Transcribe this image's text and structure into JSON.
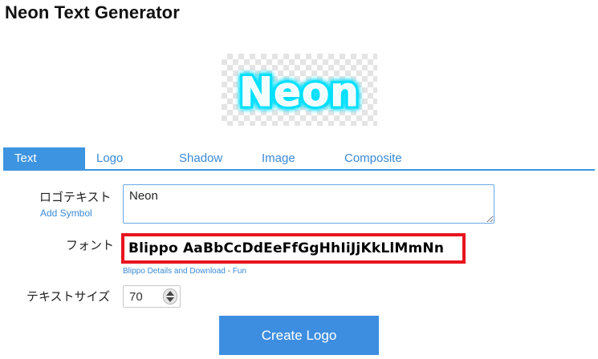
{
  "page": {
    "title": "Neon Text Generator"
  },
  "preview": {
    "text": "Neon",
    "glow_color": "#00e0ff",
    "fill_color": "#f2fdff"
  },
  "tabs": [
    {
      "label": "Text",
      "active": true
    },
    {
      "label": "Logo",
      "active": false
    },
    {
      "label": "Shadow",
      "active": false
    },
    {
      "label": "Image",
      "active": false
    },
    {
      "label": "Composite",
      "active": false
    }
  ],
  "form": {
    "logo_text": {
      "label": "ロゴテキスト",
      "value": "Neon",
      "add_symbol_link": "Add Symbol"
    },
    "font": {
      "label": "フォント",
      "sample": "Blippo AaBbCcDdEeFfGgHhIiJjKkLlMmNn",
      "details_link": "Blippo Details and Download",
      "separator": "-",
      "category_link": "Fun"
    },
    "text_size": {
      "label": "テキストサイズ",
      "value": "70"
    }
  },
  "actions": {
    "create_label": "Create Logo"
  },
  "colors": {
    "accent": "#3d94e0",
    "link": "#3a8ad6",
    "font_highlight_border": "#e8141e"
  }
}
